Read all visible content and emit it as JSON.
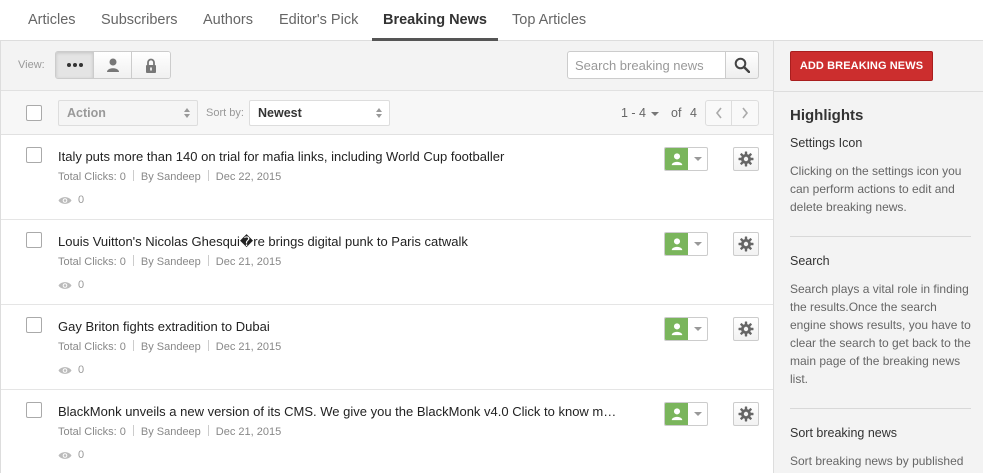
{
  "tabs": [
    {
      "label": "Articles"
    },
    {
      "label": "Subscribers"
    },
    {
      "label": "Authors"
    },
    {
      "label": "Editor's Pick"
    },
    {
      "label": "Breaking News",
      "active": true
    },
    {
      "label": "Top Articles"
    }
  ],
  "toolbar": {
    "view_label": "View:",
    "view_buttons": [
      "more-icon",
      "user-icon",
      "lock-icon"
    ],
    "search_placeholder": "Search breaking news"
  },
  "filter": {
    "action_label": "Action",
    "sort_label": "Sort by:",
    "sort_value": "Newest",
    "range": "1 - 4",
    "of_label": "of",
    "total": "4"
  },
  "items": [
    {
      "title": "Italy puts more than 140 on trial for mafia links, including World Cup footballer",
      "clicks": "Total Clicks: 0",
      "author": "By Sandeep",
      "date": "Dec 22, 2015",
      "views": "0"
    },
    {
      "title": "Louis Vuitton's Nicolas Ghesqui�re brings digital punk to Paris catwalk",
      "clicks": "Total Clicks: 0",
      "author": "By Sandeep",
      "date": "Dec 21, 2015",
      "views": "0"
    },
    {
      "title": "Gay Briton fights extradition to Dubai",
      "clicks": "Total Clicks: 0",
      "author": "By Sandeep",
      "date": "Dec 21, 2015",
      "views": "0"
    },
    {
      "title": "BlackMonk unveils a new version of its CMS. We give you the BlackMonk v4.0 Click to know m…",
      "clicks": "Total Clicks: 0",
      "author": "By Sandeep",
      "date": "Dec 21, 2015",
      "views": "0"
    }
  ],
  "sidebar": {
    "add_button": "ADD BREAKING NEWS",
    "highlights_title": "Highlights",
    "sections": [
      {
        "title": "Settings Icon",
        "body": "Clicking on the settings icon you can perform actions to edit and delete breaking news."
      },
      {
        "title": "Search",
        "body": "Search plays a vital role in finding the results.Once the search engine shows results, you have to clear the search to get back to the main page of the breaking news list."
      },
      {
        "title": "Sort breaking news",
        "body": "Sort breaking news by published"
      }
    ]
  },
  "colors": {
    "accent_red": "#cc2e2e",
    "status_green": "#7ab55c"
  }
}
